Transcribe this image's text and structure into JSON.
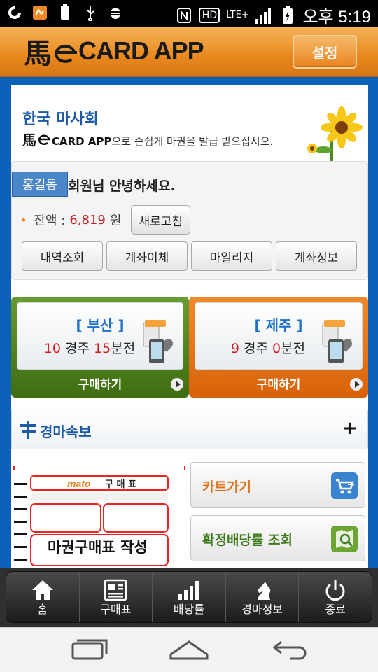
{
  "status_bar": {
    "time": "오후 5:19",
    "network": "LTE+",
    "icons": [
      "signal-app-icon",
      "note-icon",
      "battery-100-icon",
      "usb-icon",
      "android-debug-icon",
      "nfc-icon",
      "hd-voice-icon",
      "lte-icon",
      "cell-signal-icon",
      "battery-charging-icon"
    ]
  },
  "header": {
    "logo_mark": "馬",
    "logo_text": "CARD APP",
    "settings_label": "설정"
  },
  "banner": {
    "title": "한국 마사회",
    "subtitle_mark": "馬",
    "subtitle_brand": "CARD APP",
    "subtitle_text": "으로 손쉽게 마권을 발급 받으십시오."
  },
  "member": {
    "user_name": "홍길동",
    "greeting": "회원님 안녕하세요.",
    "balance_label": "잔액 :",
    "balance_value": "6,819",
    "balance_unit": "원",
    "refresh_label": "새로고침",
    "menu": [
      "내역조회",
      "계좌이체",
      "마일리지",
      "계좌정보"
    ]
  },
  "races": [
    {
      "name": "[ 부산 ]",
      "race_no": "10",
      "race_unit": "경주",
      "minutes": "15",
      "minutes_unit": "분전",
      "buy_label": "구매하기",
      "color": "#4f8220"
    },
    {
      "name": "[ 제주 ]",
      "race_no": "9",
      "race_unit": "경주",
      "minutes": "0",
      "minutes_unit": "분전",
      "buy_label": "구매하기",
      "color": "#e2720f"
    }
  ],
  "news": {
    "title": "경마속보",
    "expand": "+"
  },
  "ticket": {
    "caption": "마권구매표 작성",
    "form_title": "구 매 표",
    "form_brand": "mato"
  },
  "side_buttons": {
    "cart": "카트가기",
    "odds": "확정배당률 조회"
  },
  "tabs": [
    "홈",
    "구매표",
    "배당률",
    "경마정보",
    "종료"
  ],
  "colors": {
    "header_orange": "#e88a1e",
    "main_blue": "#0b62b8",
    "accent_red": "#d41c1c"
  }
}
